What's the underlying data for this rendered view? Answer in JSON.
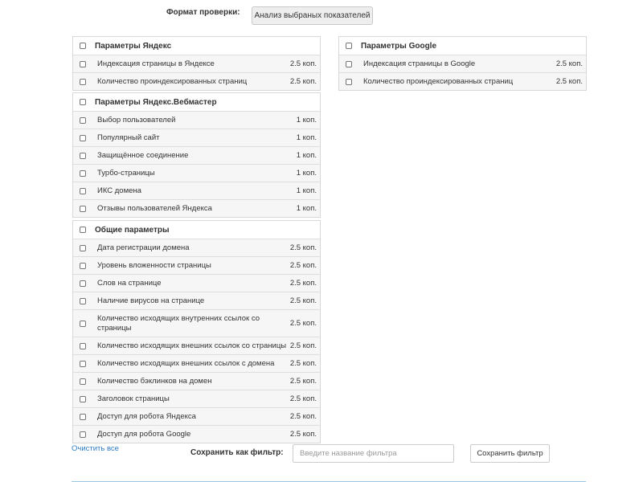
{
  "header": {
    "format_label": "Формат проверки:",
    "format_value": "Анализ выбраных показателей"
  },
  "groups": {
    "yandex": {
      "title": "Параметры Яндекс",
      "items": [
        {
          "label": "Индексация страницы в Яндексе",
          "price": "2.5 коп."
        },
        {
          "label": "Количество проиндексированных страниц",
          "price": "2.5 коп."
        }
      ]
    },
    "webmaster": {
      "title": "Параметры Яндекс.Вебмастер",
      "items": [
        {
          "label": "Выбор пользователей",
          "price": "1 коп."
        },
        {
          "label": "Популярный сайт",
          "price": "1 коп."
        },
        {
          "label": "Защищённое соединение",
          "price": "1 коп."
        },
        {
          "label": "Турбо-страницы",
          "price": "1 коп."
        },
        {
          "label": "ИКС домена",
          "price": "1 коп."
        },
        {
          "label": "Отзывы пользователей Яндекса",
          "price": "1 коп."
        }
      ]
    },
    "general": {
      "title": "Общие параметры",
      "items": [
        {
          "label": "Дата регистрации домена",
          "price": "2.5 коп."
        },
        {
          "label": "Уровень вложенности страницы",
          "price": "2.5 коп."
        },
        {
          "label": "Слов на странице",
          "price": "2.5 коп."
        },
        {
          "label": "Наличие вирусов на странице",
          "price": "2.5 коп."
        },
        {
          "label": "Количество исходящих внутренних ссылок со страницы",
          "price": "2.5 коп."
        },
        {
          "label": "Количество исходящих внешних ссылок со страницы",
          "price": "2.5 коп."
        },
        {
          "label": "Количество исходящих внешних ссылок с домена",
          "price": "2.5 коп."
        },
        {
          "label": "Количество бэклинков на домен",
          "price": "2.5 коп."
        },
        {
          "label": "Заголовок страницы",
          "price": "2.5 коп."
        },
        {
          "label": "Доступ для робота Яндекса",
          "price": "2.5 коп."
        },
        {
          "label": "Доступ для робота Google",
          "price": "2.5 коп."
        }
      ]
    },
    "google": {
      "title": "Параметры Google",
      "items": [
        {
          "label": "Индексация страницы в Google",
          "price": "2.5 коп."
        },
        {
          "label": "Количество проиндексированных страниц",
          "price": "2.5 коп."
        }
      ]
    }
  },
  "footer": {
    "clear_link": "Очистить все",
    "save_label": "Сохранить как фильтр:",
    "filter_input_value": "",
    "filter_input_placeholder": "Введите название фильтра",
    "save_button": "Сохранить фильтр"
  }
}
